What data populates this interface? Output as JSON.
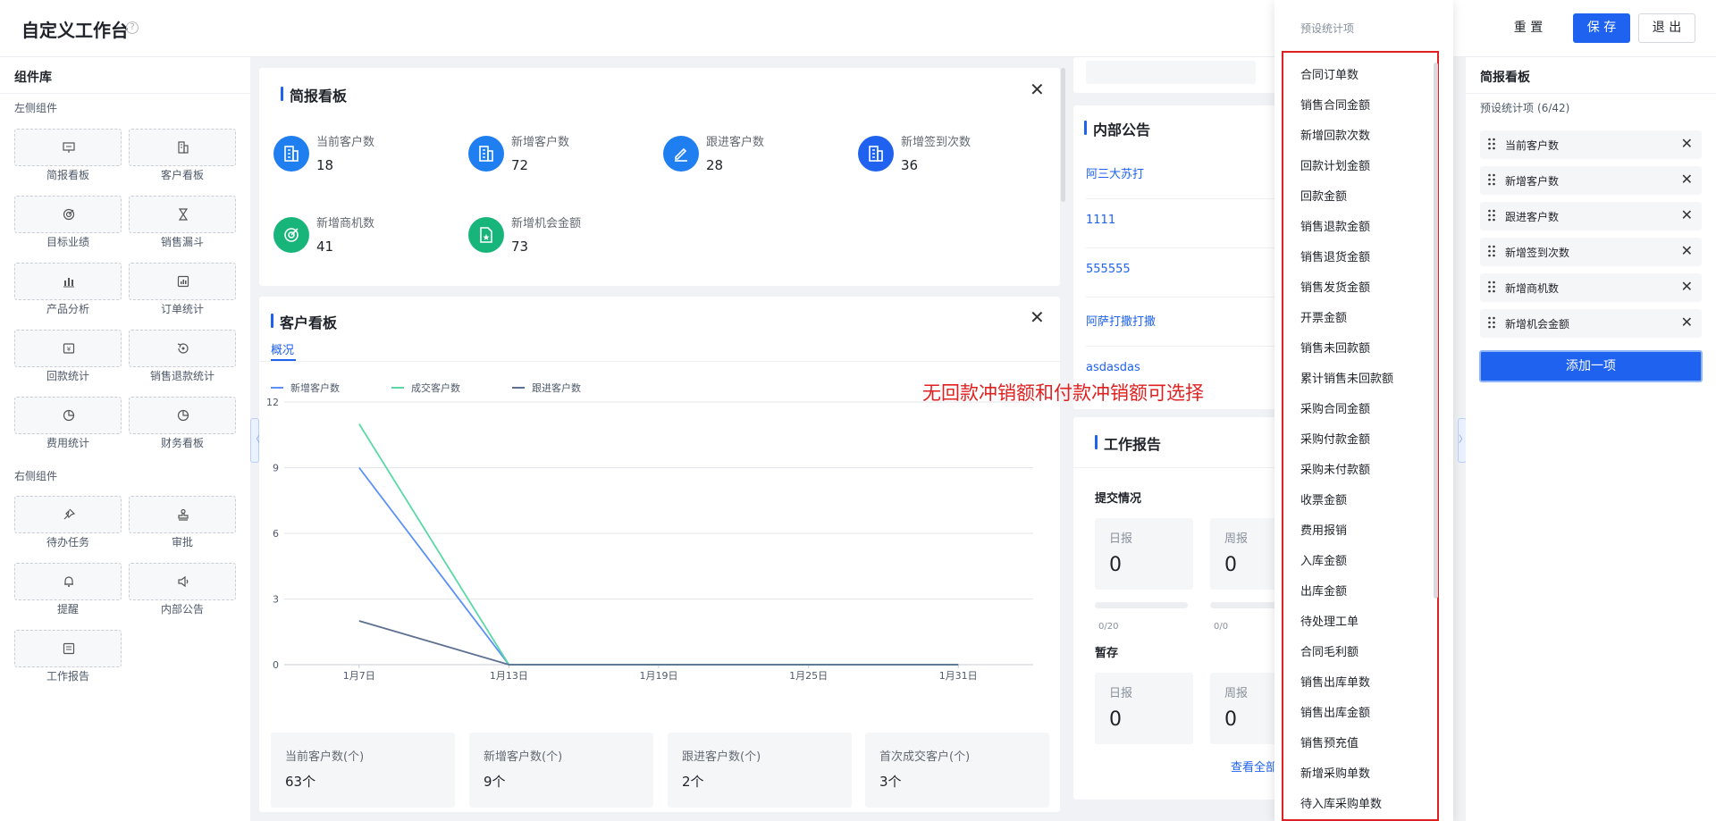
{
  "header": {
    "title": "自定义工作台",
    "help_icon": "?",
    "reset_label": "重 置",
    "save_label": "保 存",
    "exit_label": "退 出"
  },
  "left_panel": {
    "title": "组件库",
    "section_left": "左侧组件",
    "section_right": "右侧组件",
    "left_components": [
      {
        "label": "简报看板",
        "icon": "presentation-icon"
      },
      {
        "label": "客户看板",
        "icon": "building-icon"
      },
      {
        "label": "目标业绩",
        "icon": "target-icon"
      },
      {
        "label": "销售漏斗",
        "icon": "hourglass-icon"
      },
      {
        "label": "产品分析",
        "icon": "bar-chart-icon"
      },
      {
        "label": "订单统计",
        "icon": "order-chart-icon"
      },
      {
        "label": "回款统计",
        "icon": "payment-icon"
      },
      {
        "label": "销售退款统计",
        "icon": "refund-icon"
      },
      {
        "label": "费用统计",
        "icon": "pie-icon"
      },
      {
        "label": "财务看板",
        "icon": "pie-icon"
      }
    ],
    "right_components": [
      {
        "label": "待办任务",
        "icon": "pin-icon"
      },
      {
        "label": "审批",
        "icon": "stamp-icon"
      },
      {
        "label": "提醒",
        "icon": "bell-icon"
      },
      {
        "label": "内部公告",
        "icon": "speaker-icon"
      },
      {
        "label": "工作报告",
        "icon": "report-icon"
      }
    ]
  },
  "briefing": {
    "title": "简报看板",
    "stats": [
      {
        "label": "当前客户数",
        "value": "18",
        "color": "#1f7ef0"
      },
      {
        "label": "新增客户数",
        "value": "72",
        "color": "#1f7ef0"
      },
      {
        "label": "跟进客户数",
        "value": "28",
        "color": "#1f7ef0"
      },
      {
        "label": "新增签到次数",
        "value": "36",
        "color": "#1f62f0"
      },
      {
        "label": "新增商机数",
        "value": "41",
        "color": "#18b57a"
      },
      {
        "label": "新增机会金额",
        "value": "73",
        "color": "#18b57a"
      }
    ]
  },
  "customer_board": {
    "title": "客户看板",
    "tab": "概况",
    "summary": [
      {
        "label": "当前客户数(个)",
        "value": "63个"
      },
      {
        "label": "新增客户数(个)",
        "value": "9个"
      },
      {
        "label": "跟进客户数(个)",
        "value": "2个"
      },
      {
        "label": "首次成交客户(个)",
        "value": "3个"
      }
    ]
  },
  "chart_data": {
    "type": "line",
    "x": [
      "1月7日",
      "1月13日",
      "1月19日",
      "1月25日",
      "1月31日"
    ],
    "ylim": [
      0,
      12
    ],
    "yticks": [
      0,
      3,
      6,
      9,
      12
    ],
    "grid": true,
    "legend": "top-left",
    "series": [
      {
        "name": "新增客户数",
        "color": "#5b8ff9",
        "points": [
          [
            0,
            9
          ],
          [
            1,
            0
          ],
          [
            4,
            0
          ]
        ]
      },
      {
        "name": "成交客户数",
        "color": "#5ad8a6",
        "points": [
          [
            0,
            11
          ],
          [
            1,
            0
          ],
          [
            4,
            0
          ]
        ]
      },
      {
        "name": "跟进客户数",
        "color": "#5d7092",
        "points": [
          [
            0,
            2
          ],
          [
            1,
            0
          ],
          [
            4,
            0
          ]
        ]
      }
    ]
  },
  "notices": {
    "title": "内部公告",
    "items": [
      "阿三大苏打",
      "1111",
      "555555",
      "阿萨打撒打撒",
      "asdasdas"
    ]
  },
  "work_report": {
    "title": "工作报告",
    "submit_label": "提交情况",
    "draft_label": "暂存",
    "daily": "日报",
    "weekly": "周报",
    "submit_daily_value": "0",
    "submit_weekly_value": "0",
    "submit_daily_frac": "0/20",
    "submit_weekly_frac": "0/0",
    "draft_daily_value": "0",
    "draft_weekly_value": "0",
    "view_all": "查看全部"
  },
  "annotation": "无回款冲销额和付款冲销额可选择",
  "dropdown": {
    "title": "预设统计项",
    "items": [
      "合同订单数",
      "销售合同金额",
      "新增回款次数",
      "回款计划金额",
      "回款金额",
      "销售退款金额",
      "销售退货金额",
      "销售发货金额",
      "开票金额",
      "销售未回款额",
      "累计销售未回款额",
      "采购合同金额",
      "采购付款金额",
      "采购未付款额",
      "收票金额",
      "费用报销",
      "入库金额",
      "出库金额",
      "待处理工单",
      "合同毛利额",
      "销售出库单数",
      "销售出库金额",
      "销售预充值",
      "新增采购单数",
      "待入库采购单数"
    ]
  },
  "right_panel": {
    "title": "简报看板",
    "subtitle": "预设统计项",
    "count": "(6/42)",
    "items": [
      "当前客户数",
      "新增客户数",
      "跟进客户数",
      "新增签到次数",
      "新增商机数",
      "新增机会金额"
    ],
    "add_label": "添加一项"
  },
  "colors": {
    "accent": "#1f62f0",
    "annotation": "#e02020"
  }
}
